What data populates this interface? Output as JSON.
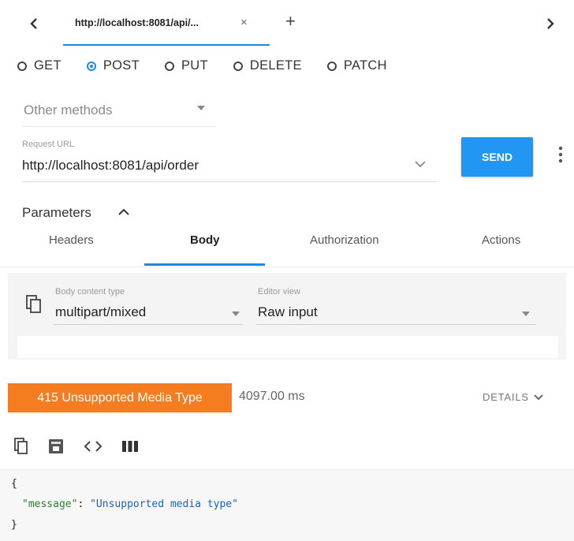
{
  "tab": {
    "title": "http://localhost:8081/api/...",
    "close": "×",
    "new_tab": "+"
  },
  "methods": [
    {
      "label": "GET",
      "selected": false
    },
    {
      "label": "POST",
      "selected": true
    },
    {
      "label": "PUT",
      "selected": false
    },
    {
      "label": "DELETE",
      "selected": false
    },
    {
      "label": "PATCH",
      "selected": false
    }
  ],
  "other_methods": "Other methods",
  "request": {
    "url_caption": "Request URL",
    "url": "http://localhost:8081/api/order",
    "send_label": "SEND"
  },
  "parameters": {
    "title": "Parameters",
    "tabs": [
      "Headers",
      "Body",
      "Authorization",
      "Actions"
    ],
    "active_tab": "Body"
  },
  "body": {
    "content_type_caption": "Body content type",
    "content_type": "multipart/mixed",
    "editor_caption": "Editor view",
    "editor_view": "Raw input"
  },
  "response": {
    "status": "415 Unsupported Media Type",
    "time": "4097.00 ms",
    "details_label": "DETAILS",
    "json_open": "{",
    "json_key": "\"message\"",
    "json_colon": ": ",
    "json_value": "\"Unsupported media type\"",
    "json_close": "}"
  },
  "colors": {
    "accent": "#2196f3",
    "status_error": "#f57c1f",
    "panel_bg": "#f4f4f4"
  },
  "icons": [
    "chevron-left-icon",
    "chevron-right-icon",
    "close-icon",
    "plus-icon",
    "caret-down-icon",
    "more-vert-icon",
    "chevron-up-icon",
    "copy-icon",
    "save-icon",
    "code-icon",
    "columns-icon",
    "chevron-down-icon"
  ]
}
